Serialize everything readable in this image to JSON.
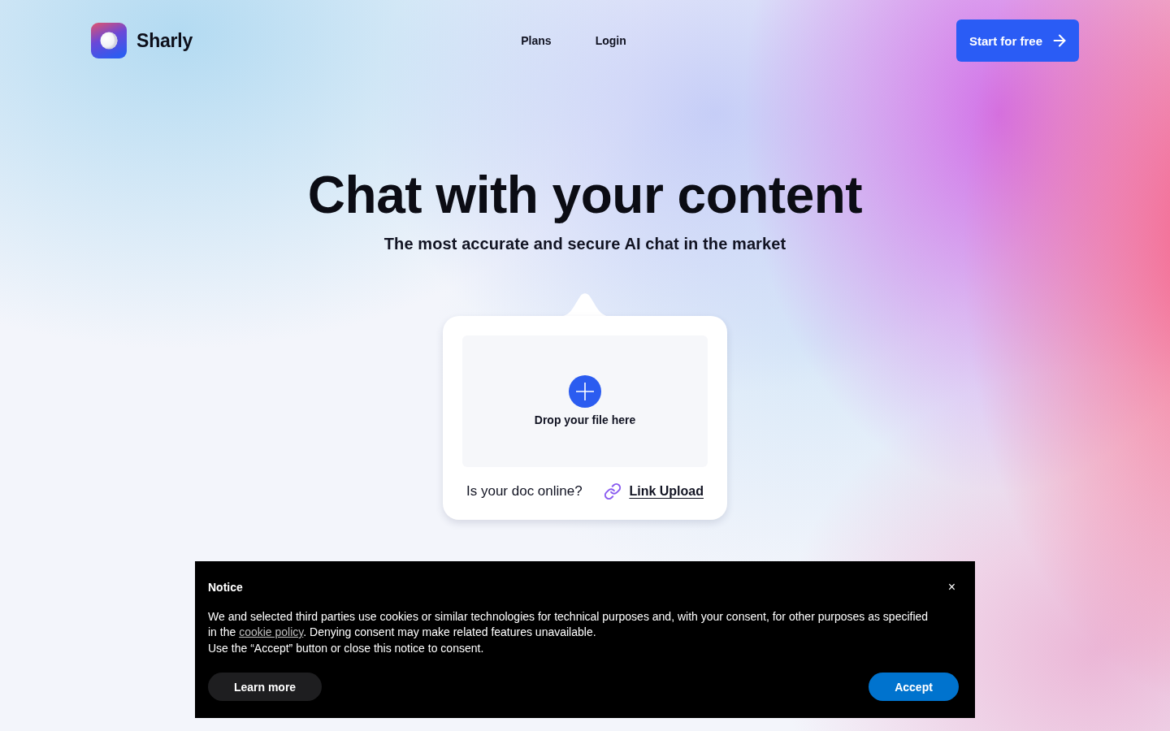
{
  "header": {
    "logo": {
      "name": "Sharly"
    },
    "nav": [
      {
        "label": "Plans"
      },
      {
        "label": "Login"
      }
    ],
    "cta": {
      "label": "Start for free"
    }
  },
  "hero": {
    "title": "Chat with your content",
    "subtitle": "The most accurate and secure AI chat in the market"
  },
  "upload": {
    "dropzone_label": "Drop your file here",
    "online_prompt": "Is your doc online?",
    "link_label": "Link Upload"
  },
  "notice": {
    "title": "Notice",
    "close": "×",
    "body": {
      "before": "We and selected third parties use cookies or similar technologies for technical purposes and, with your consent, for other purposes as specified in the ",
      "link": "cookie policy",
      "after": ". Denying consent may make related features unavailable."
    },
    "consent_line": "Use the “Accept” button or close this notice to consent.",
    "buttons": [
      {
        "kind": "secondary",
        "label": "Learn more"
      },
      {
        "kind": "primary",
        "label": "Accept"
      }
    ]
  }
}
